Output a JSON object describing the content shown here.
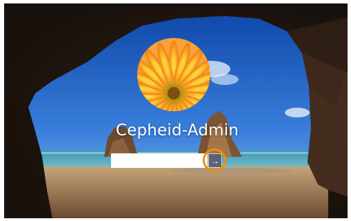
{
  "login": {
    "username": "Cepheid-Admin",
    "password_value": "",
    "password_placeholder": "",
    "submit_icon": "arrow-right-icon",
    "submit_glyph": "→"
  },
  "colors": {
    "highlight_ring": "#f48c06",
    "username_text": "#ffffff",
    "sky": "#2f6fd0",
    "sea": "#3a9bb8",
    "sand": "#b99466"
  },
  "background": "windows-10-cave-beach-wallpaper",
  "avatar": "orange-gerbera-flower"
}
